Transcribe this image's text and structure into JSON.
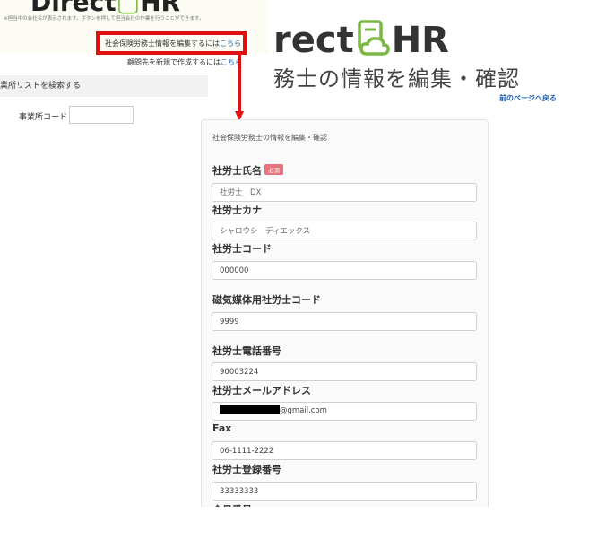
{
  "background": {
    "logo_text": "Direct",
    "logo_accent": "HR",
    "notice": "※担当中の会社名が表示されます。ボタンを押して担当会社の作業を行うことができます。",
    "edit_prefix": "社会保険労務士情報を編集するには",
    "edit_link": "こちら",
    "new_prefix": "顧問先を新規で作成するには",
    "new_link": "こちら",
    "search_bar": "業所リストを検索する",
    "office_code_label": "事業所コード"
  },
  "brand": {
    "text_left": "rect",
    "text_right": "HR",
    "icon": "document-cloud-icon",
    "accent_color": "#7bb743"
  },
  "page": {
    "heading": "務士の情報を編集・確認",
    "back_link": "前のページへ戻る"
  },
  "form": {
    "title": "社会保険労務士の情報を編集・確認",
    "required_badge": "必須",
    "fields": {
      "name": {
        "label": "社労士氏名",
        "value": "社労士　DX"
      },
      "kana": {
        "label": "社労士カナ",
        "value": "シャロウシ　ディエックス"
      },
      "code": {
        "label": "社労士コード",
        "value": "000000"
      },
      "media_code": {
        "label": "磁気媒体用社労士コード",
        "value": "9999"
      },
      "phone": {
        "label": "社労士電話番号",
        "value": "90003224"
      },
      "email": {
        "label": "社労士メールアドレス",
        "value_suffix": "@gmail.com"
      },
      "fax": {
        "label": "Fax",
        "value": "06-1111-2222"
      },
      "reg_no": {
        "label": "社労士登録番号",
        "value": "33333333"
      },
      "member_no": {
        "label": "会員番号"
      }
    }
  },
  "colors": {
    "highlight": "#e01010",
    "link": "#1a5fb4",
    "required": "#e8727c"
  }
}
